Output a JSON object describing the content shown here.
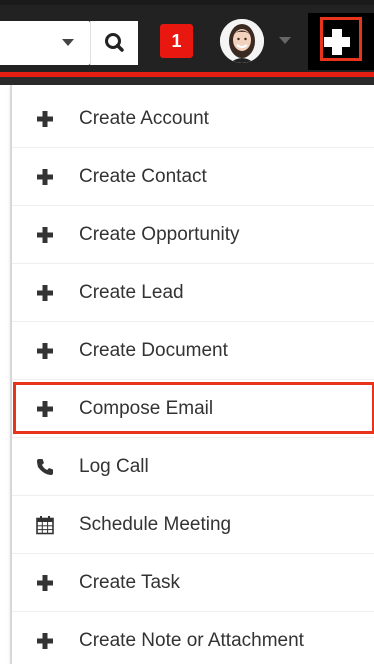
{
  "header": {
    "notification_count": "1",
    "accent_color": "#e61e12"
  },
  "menu": {
    "items": [
      {
        "label": "Create Account",
        "icon": "plus-icon"
      },
      {
        "label": "Create Contact",
        "icon": "plus-icon"
      },
      {
        "label": "Create Opportunity",
        "icon": "plus-icon"
      },
      {
        "label": "Create Lead",
        "icon": "plus-icon"
      },
      {
        "label": "Create Document",
        "icon": "plus-icon"
      },
      {
        "label": "Compose Email",
        "icon": "plus-icon",
        "highlighted": true
      },
      {
        "label": "Log Call",
        "icon": "phone-icon"
      },
      {
        "label": "Schedule Meeting",
        "icon": "calendar-icon"
      },
      {
        "label": "Create Task",
        "icon": "plus-icon"
      },
      {
        "label": "Create Note or Attachment",
        "icon": "plus-icon"
      }
    ]
  }
}
